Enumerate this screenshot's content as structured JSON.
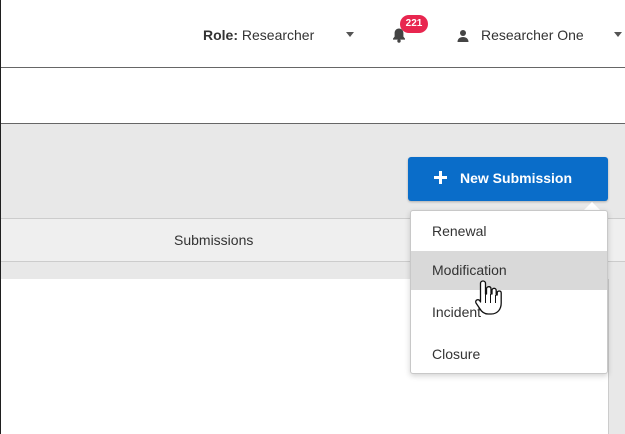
{
  "header": {
    "role_label": "Role:",
    "role_value": "Researcher",
    "notification_count": "221",
    "user_name": "Researcher One",
    "icons": {
      "role_dropdown": "chevron-down-icon",
      "notifications": "bell-icon",
      "user": "user-icon",
      "user_dropdown": "chevron-down-icon"
    },
    "badge_color": "#e8264f"
  },
  "toolbar": {
    "new_submission_label": "New Submission",
    "new_submission_icon": "plus-icon",
    "button_color": "#0a6dc9"
  },
  "tabs": {
    "submissions_label": "Submissions"
  },
  "new_submission_menu": {
    "items": [
      {
        "label": "Renewal",
        "hovered": false
      },
      {
        "label": "Modification",
        "hovered": true
      },
      {
        "label": "Incident",
        "hovered": false
      },
      {
        "label": "Closure",
        "hovered": false
      }
    ]
  }
}
